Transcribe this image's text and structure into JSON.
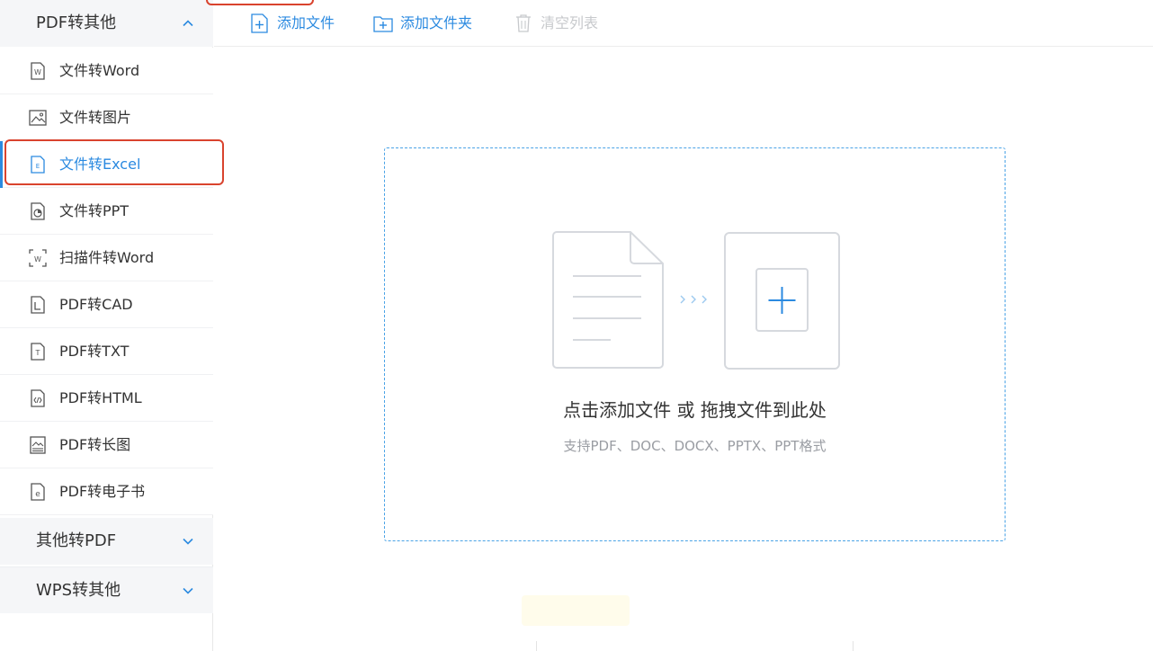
{
  "sidebar": {
    "groups": {
      "pdf_to_other": "PDF转其他",
      "other_to_pdf": "其他转PDF",
      "wps_to_other": "WPS转其他"
    },
    "items": [
      {
        "label": "文件转Word",
        "icon": "word-file-icon"
      },
      {
        "label": "文件转图片",
        "icon": "image-icon"
      },
      {
        "label": "文件转Excel",
        "icon": "excel-file-icon"
      },
      {
        "label": "文件转PPT",
        "icon": "ppt-file-icon"
      },
      {
        "label": "扫描件转Word",
        "icon": "scan-word-icon"
      },
      {
        "label": "PDF转CAD",
        "icon": "cad-file-icon"
      },
      {
        "label": "PDF转TXT",
        "icon": "txt-file-icon"
      },
      {
        "label": "PDF转HTML",
        "icon": "html-file-icon"
      },
      {
        "label": "PDF转长图",
        "icon": "long-image-icon"
      },
      {
        "label": "PDF转电子书",
        "icon": "ebook-file-icon"
      }
    ],
    "active_index": 2
  },
  "toolbar": {
    "add_file": "添加文件",
    "add_folder": "添加文件夹",
    "clear_list": "清空列表"
  },
  "dropzone": {
    "title": "点击添加文件 或 拖拽文件到此处",
    "subtitle": "支持PDF、DOC、DOCX、PPTX、PPT格式"
  },
  "colors": {
    "accent": "#2b8ae0",
    "highlight": "#d9432e",
    "group_bg": "#f5f6f8",
    "dashed_border": "#4aa3e6"
  }
}
